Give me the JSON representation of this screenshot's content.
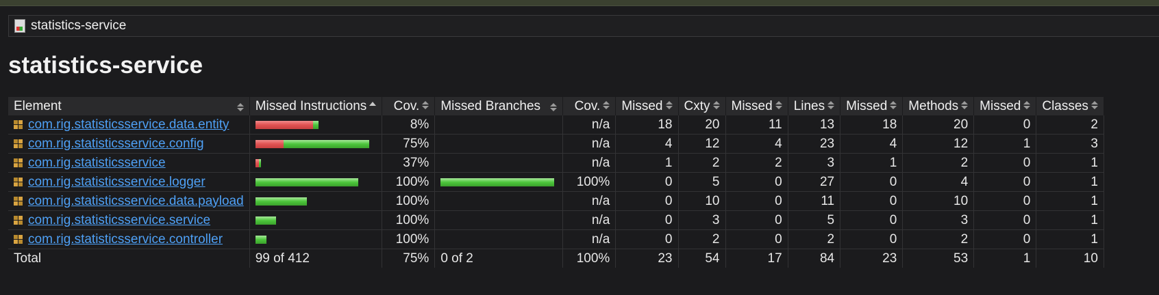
{
  "breadcrumb": {
    "label": "statistics-service"
  },
  "page_title": "statistics-service",
  "table": {
    "headers": [
      "Element",
      "Missed Instructions",
      "Cov.",
      "Missed Branches",
      "Cov.",
      "Missed",
      "Cxty",
      "Missed",
      "Lines",
      "Missed",
      "Methods",
      "Missed",
      "Classes"
    ],
    "rows": [
      {
        "name": "com.rig.statisticsservice.data.entity",
        "instr_missed": 84,
        "instr_covered": 8,
        "instr_cov": "8%",
        "branch_missed": 0,
        "branch_covered": 0,
        "branch_cov": "n/a",
        "cxty_missed": "18",
        "cxty": "20",
        "lines_missed": "11",
        "lines": "13",
        "methods_missed": "18",
        "methods": "20",
        "classes_missed": "0",
        "classes": "2"
      },
      {
        "name": "com.rig.statisticsservice.config",
        "instr_missed": 41,
        "instr_covered": 125,
        "instr_cov": "75%",
        "branch_missed": 0,
        "branch_covered": 0,
        "branch_cov": "n/a",
        "cxty_missed": "4",
        "cxty": "12",
        "lines_missed": "4",
        "lines": "23",
        "methods_missed": "4",
        "methods": "12",
        "classes_missed": "1",
        "classes": "3"
      },
      {
        "name": "com.rig.statisticsservice",
        "instr_missed": 5,
        "instr_covered": 3,
        "instr_cov": "37%",
        "branch_missed": 0,
        "branch_covered": 0,
        "branch_cov": "n/a",
        "cxty_missed": "1",
        "cxty": "2",
        "lines_missed": "2",
        "lines": "3",
        "methods_missed": "1",
        "methods": "2",
        "classes_missed": "0",
        "classes": "1"
      },
      {
        "name": "com.rig.statisticsservice.logger",
        "instr_missed": 0,
        "instr_covered": 150,
        "instr_cov": "100%",
        "branch_missed": 0,
        "branch_covered": 2,
        "branch_cov": "100%",
        "cxty_missed": "0",
        "cxty": "5",
        "lines_missed": "0",
        "lines": "27",
        "methods_missed": "0",
        "methods": "4",
        "classes_missed": "0",
        "classes": "1"
      },
      {
        "name": "com.rig.statisticsservice.data.payload",
        "instr_missed": 0,
        "instr_covered": 75,
        "instr_cov": "100%",
        "branch_missed": 0,
        "branch_covered": 0,
        "branch_cov": "n/a",
        "cxty_missed": "0",
        "cxty": "10",
        "lines_missed": "0",
        "lines": "11",
        "methods_missed": "0",
        "methods": "10",
        "classes_missed": "0",
        "classes": "1"
      },
      {
        "name": "com.rig.statisticsservice.service",
        "instr_missed": 0,
        "instr_covered": 30,
        "instr_cov": "100%",
        "branch_missed": 0,
        "branch_covered": 0,
        "branch_cov": "n/a",
        "cxty_missed": "0",
        "cxty": "3",
        "lines_missed": "0",
        "lines": "5",
        "methods_missed": "0",
        "methods": "3",
        "classes_missed": "0",
        "classes": "1"
      },
      {
        "name": "com.rig.statisticsservice.controller",
        "instr_missed": 0,
        "instr_covered": 16,
        "instr_cov": "100%",
        "branch_missed": 0,
        "branch_covered": 0,
        "branch_cov": "n/a",
        "cxty_missed": "0",
        "cxty": "2",
        "lines_missed": "0",
        "lines": "2",
        "methods_missed": "0",
        "methods": "2",
        "classes_missed": "0",
        "classes": "1"
      }
    ],
    "total": {
      "label": "Total",
      "instr": "99 of 412",
      "instr_cov": "75%",
      "branch": "0 of 2",
      "branch_cov": "100%",
      "cxty_missed": "23",
      "cxty": "54",
      "lines_missed": "17",
      "lines": "84",
      "methods_missed": "23",
      "methods": "53",
      "classes_missed": "1",
      "classes": "10"
    }
  },
  "colors": {
    "missed": "#e05252",
    "covered": "#4cc53b",
    "link": "#4ea0f5"
  },
  "icons": {
    "breadcrumb": "report-icon",
    "package": "package-icon",
    "sort": "sort-icon"
  }
}
